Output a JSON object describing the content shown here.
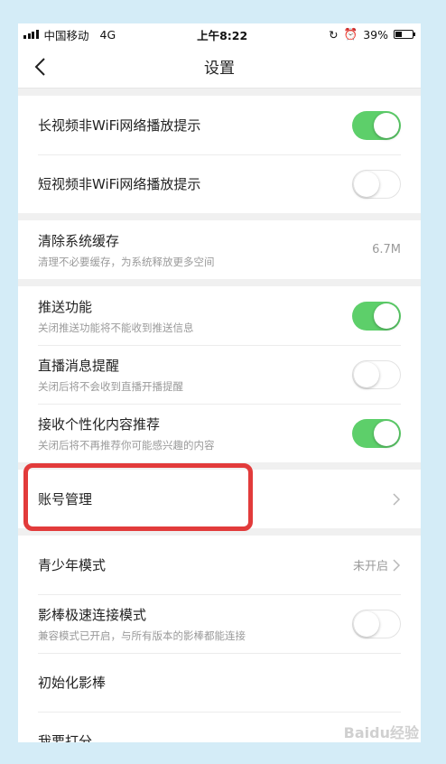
{
  "status_bar": {
    "carrier": "中国移动",
    "network": "4G",
    "time": "上午8:22",
    "battery": "39%",
    "battery_level": 0.39
  },
  "nav": {
    "title": "设置"
  },
  "groups": [
    {
      "items": [
        {
          "title": "长视频非WiFi网络播放提示",
          "toggle": "on"
        },
        {
          "title": "短视频非WiFi网络播放提示",
          "toggle": "off"
        }
      ]
    },
    {
      "items": [
        {
          "title": "清除系统缓存",
          "desc": "清理不必要缓存，为系统释放更多空间",
          "value": "6.7M"
        }
      ]
    },
    {
      "items": [
        {
          "title": "推送功能",
          "desc": "关闭推送功能将不能收到推送信息",
          "toggle": "on"
        },
        {
          "title": "直播消息提醒",
          "desc": "关闭后将不会收到直播开播提醒",
          "toggle": "off"
        },
        {
          "title": "接收个性化内容推荐",
          "desc": "关闭后将不再推荐你可能感兴趣的内容",
          "toggle": "on"
        }
      ]
    },
    {
      "items": [
        {
          "title": "账号管理"
        }
      ]
    },
    {
      "items": [
        {
          "title": "青少年模式",
          "value": "未开启"
        },
        {
          "title": "影棒极速连接模式",
          "desc": "兼容模式已开启，与所有版本的影棒都能连接",
          "toggle": "off"
        },
        {
          "title": "初始化影棒"
        },
        {
          "title": "我要打分"
        }
      ]
    }
  ],
  "watermark": "Baidu经验",
  "colors": {
    "toggle_on": "#5dcf6a",
    "highlight": "#e23b3b",
    "background": "#d4ecf7"
  }
}
